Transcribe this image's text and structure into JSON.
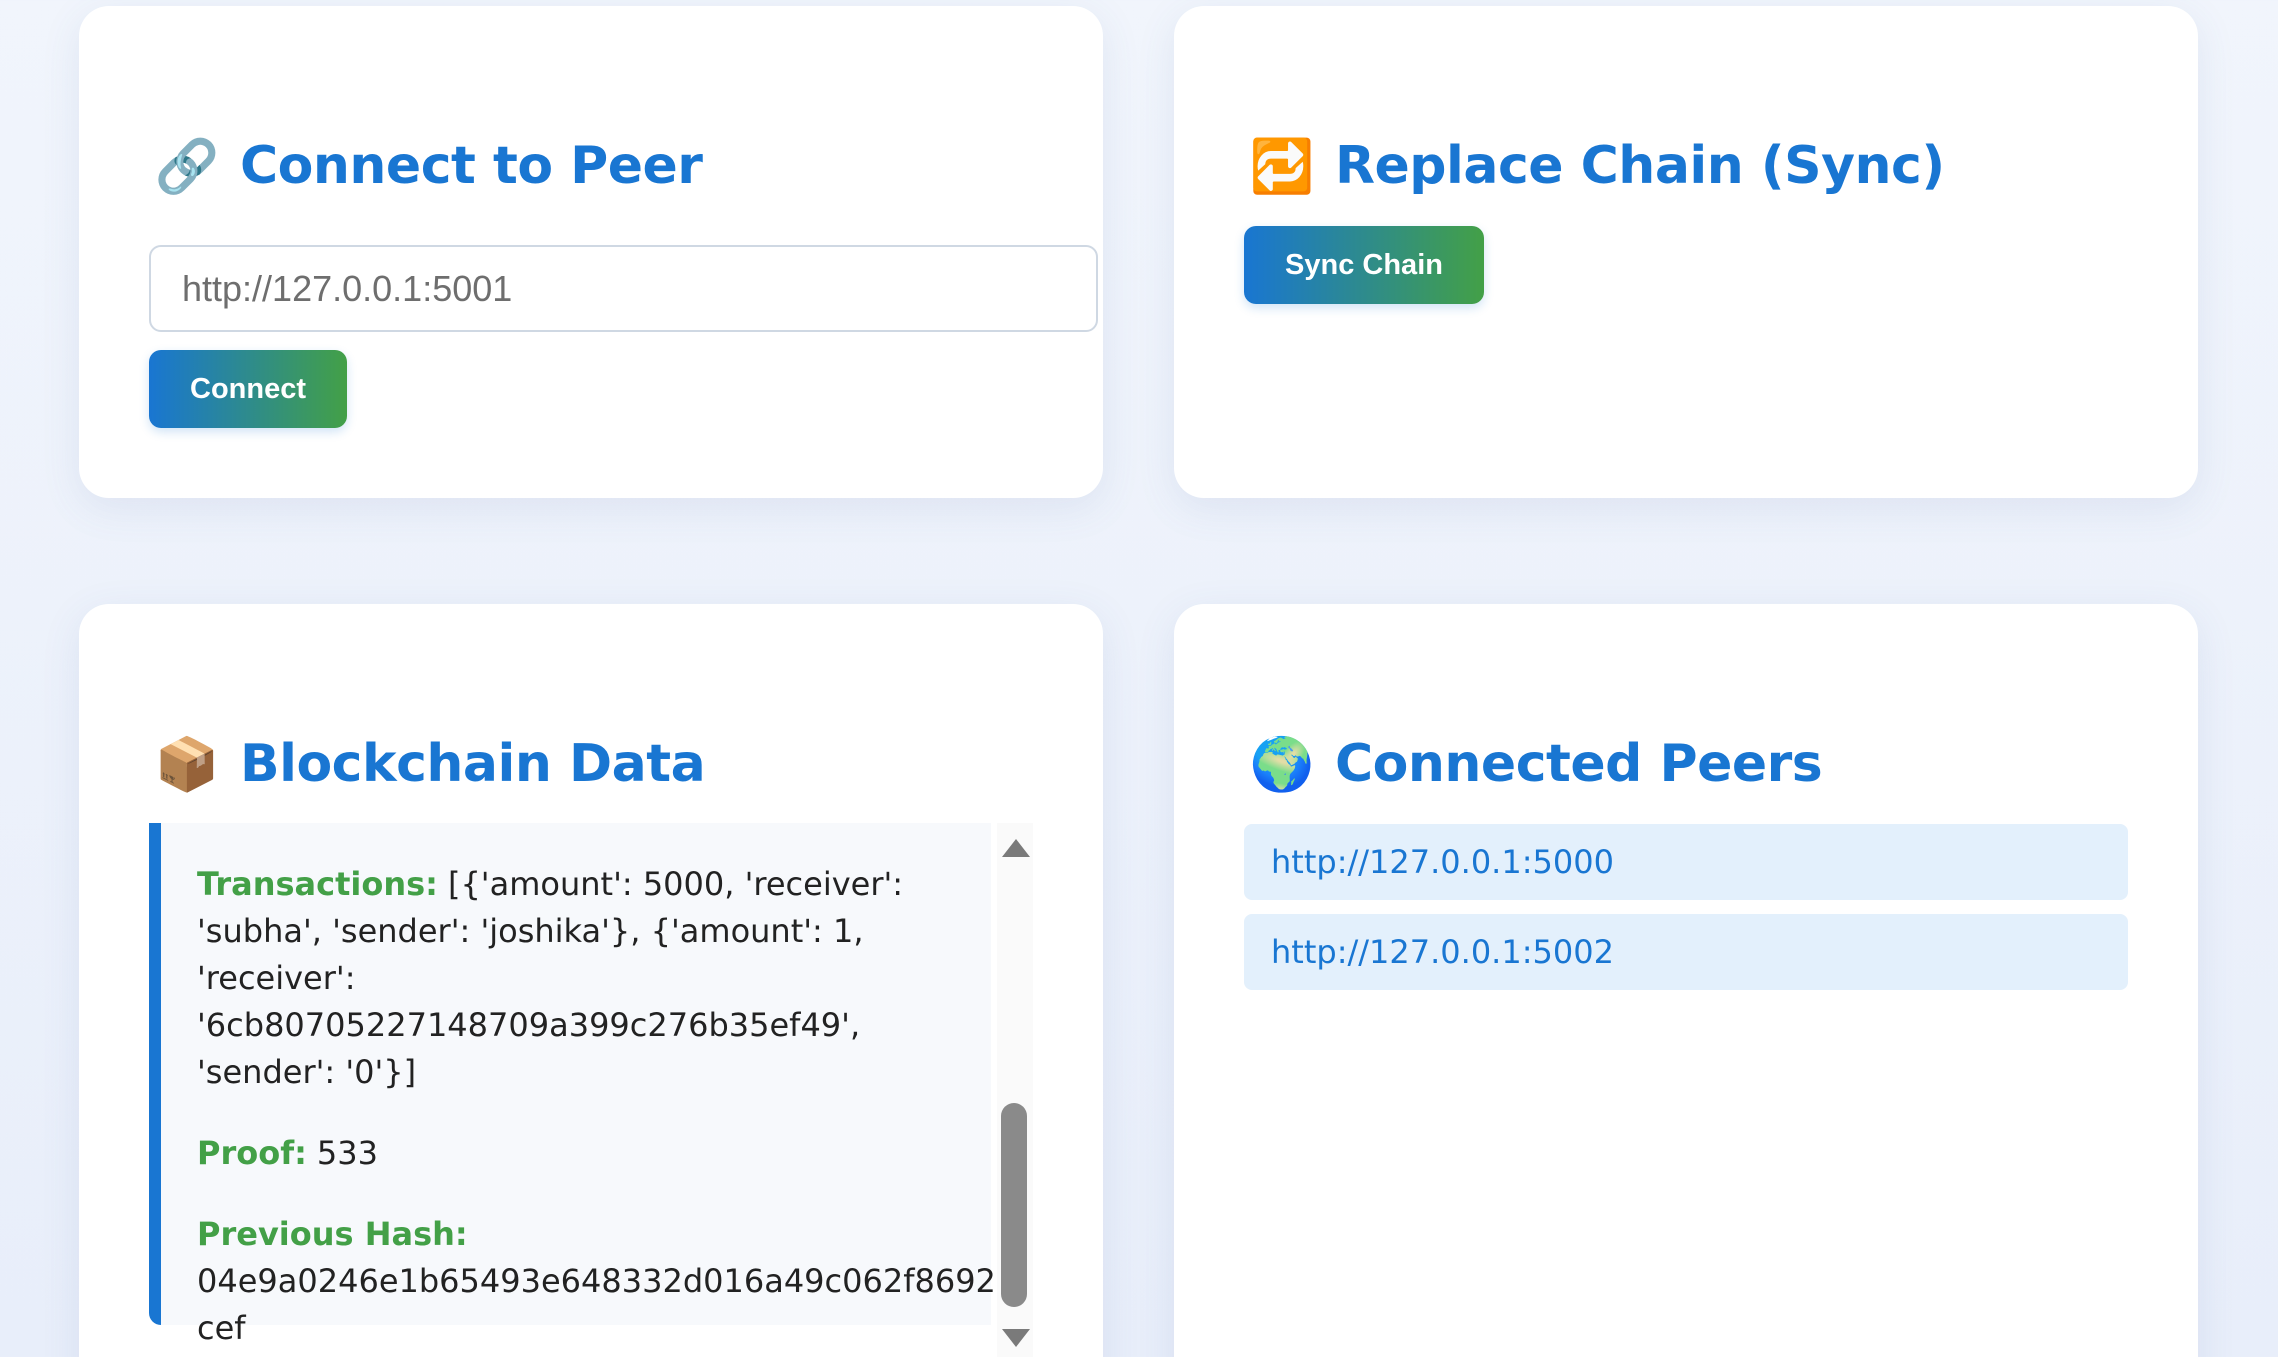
{
  "peer_card": {
    "emoji": "🔗",
    "title": "Connect to Peer",
    "input_placeholder": "http://127.0.0.1:5001",
    "input_value": "",
    "button_label": "Connect"
  },
  "sync_card": {
    "emoji": "🔁",
    "title": "Replace Chain (Sync)",
    "button_label": "Sync Chain"
  },
  "chain_card": {
    "emoji": "📦",
    "title": "Blockchain Data",
    "block": {
      "transactions_label": "Transactions:",
      "transactions_value": "[{'amount': 5000, 'receiver': 'subha', 'sender': 'joshika'}, {'amount': 1, 'receiver': '6cb80705227148709a399c276b35ef49', 'sender': '0'}]",
      "proof_label": "Proof:",
      "proof_value": "533",
      "previous_hash_label": "Previous Hash:",
      "previous_hash_value": "04e9a0246e1b65493e648332d016a49c062f8692cef"
    }
  },
  "peers_card": {
    "emoji": "🌍",
    "title": "Connected Peers",
    "peers": [
      "http://127.0.0.1:5000",
      "http://127.0.0.1:5002"
    ]
  }
}
